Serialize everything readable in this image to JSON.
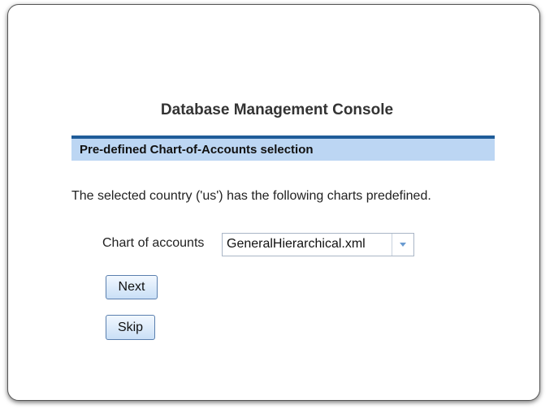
{
  "page": {
    "title": "Database Management Console",
    "section_header": "Pre-defined Chart-of-Accounts selection",
    "info_text": "The selected country ('us') has the following charts predefined."
  },
  "form": {
    "chart_of_accounts_label": "Chart of accounts",
    "chart_of_accounts_value": "GeneralHierarchical.xml",
    "next_label": "Next",
    "skip_label": "Skip"
  },
  "icons": {
    "dropdown": "chevron-down-icon"
  },
  "colors": {
    "header_bar": "#1f5c99",
    "header_bg": "#bcd6f3",
    "button_border": "#5a7fae",
    "dropdown_arrow": "#6a9bd1"
  }
}
